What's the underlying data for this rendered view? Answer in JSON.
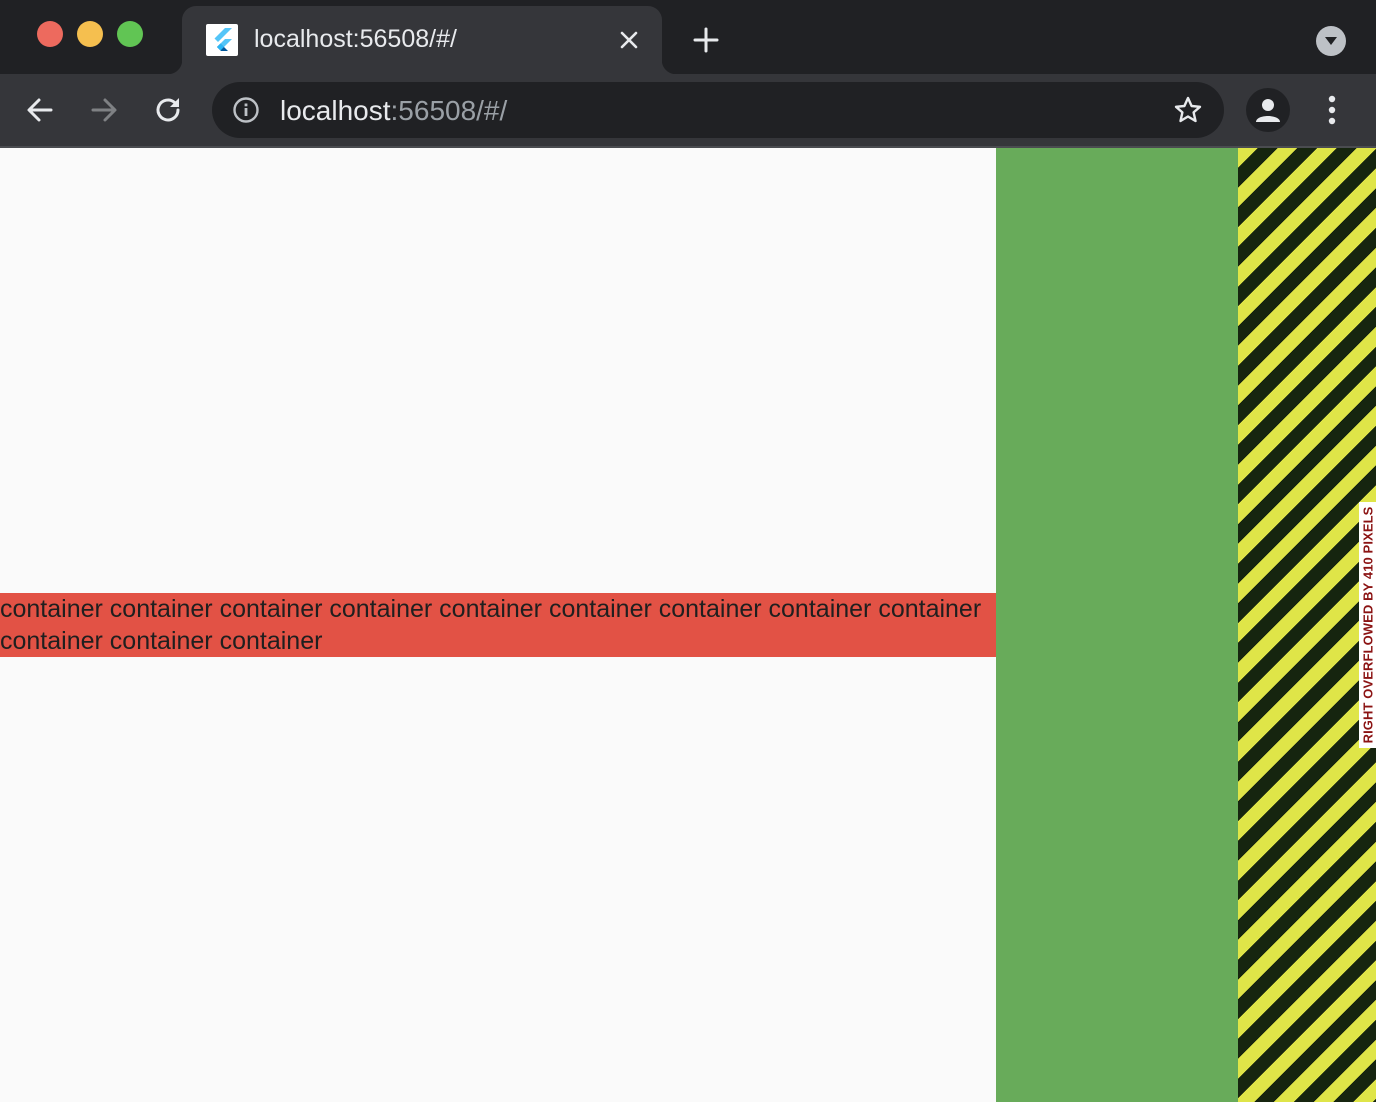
{
  "tab": {
    "title": "localhost:56508/#/",
    "favicon_icon": "flutter-logo-icon",
    "close_icon": "close-icon"
  },
  "new_tab_icon": "plus-icon",
  "tab_search_icon": "chevron-down-circle-icon",
  "toolbar": {
    "back_icon": "arrow-left-icon",
    "forward_icon": "arrow-right-icon",
    "reload_icon": "reload-icon",
    "url_host": "localhost",
    "url_rest": ":56508/#/",
    "info_icon": "info-icon",
    "bookmark_icon": "star-icon",
    "profile_icon": "person-icon",
    "menu_icon": "kebab-menu-icon"
  },
  "page": {
    "container_text": "container container container container container container container container container container container container",
    "overflow_text": "RIGHT OVERFLOWED BY 410 PIXELS",
    "colors": {
      "background": "#fafafa",
      "red_container": "#e25245",
      "green_box": "#68ab5a",
      "stripe_yellow": "#dfe548",
      "stripe_dark": "#16250f",
      "overflow_text": "#8b1313"
    }
  }
}
